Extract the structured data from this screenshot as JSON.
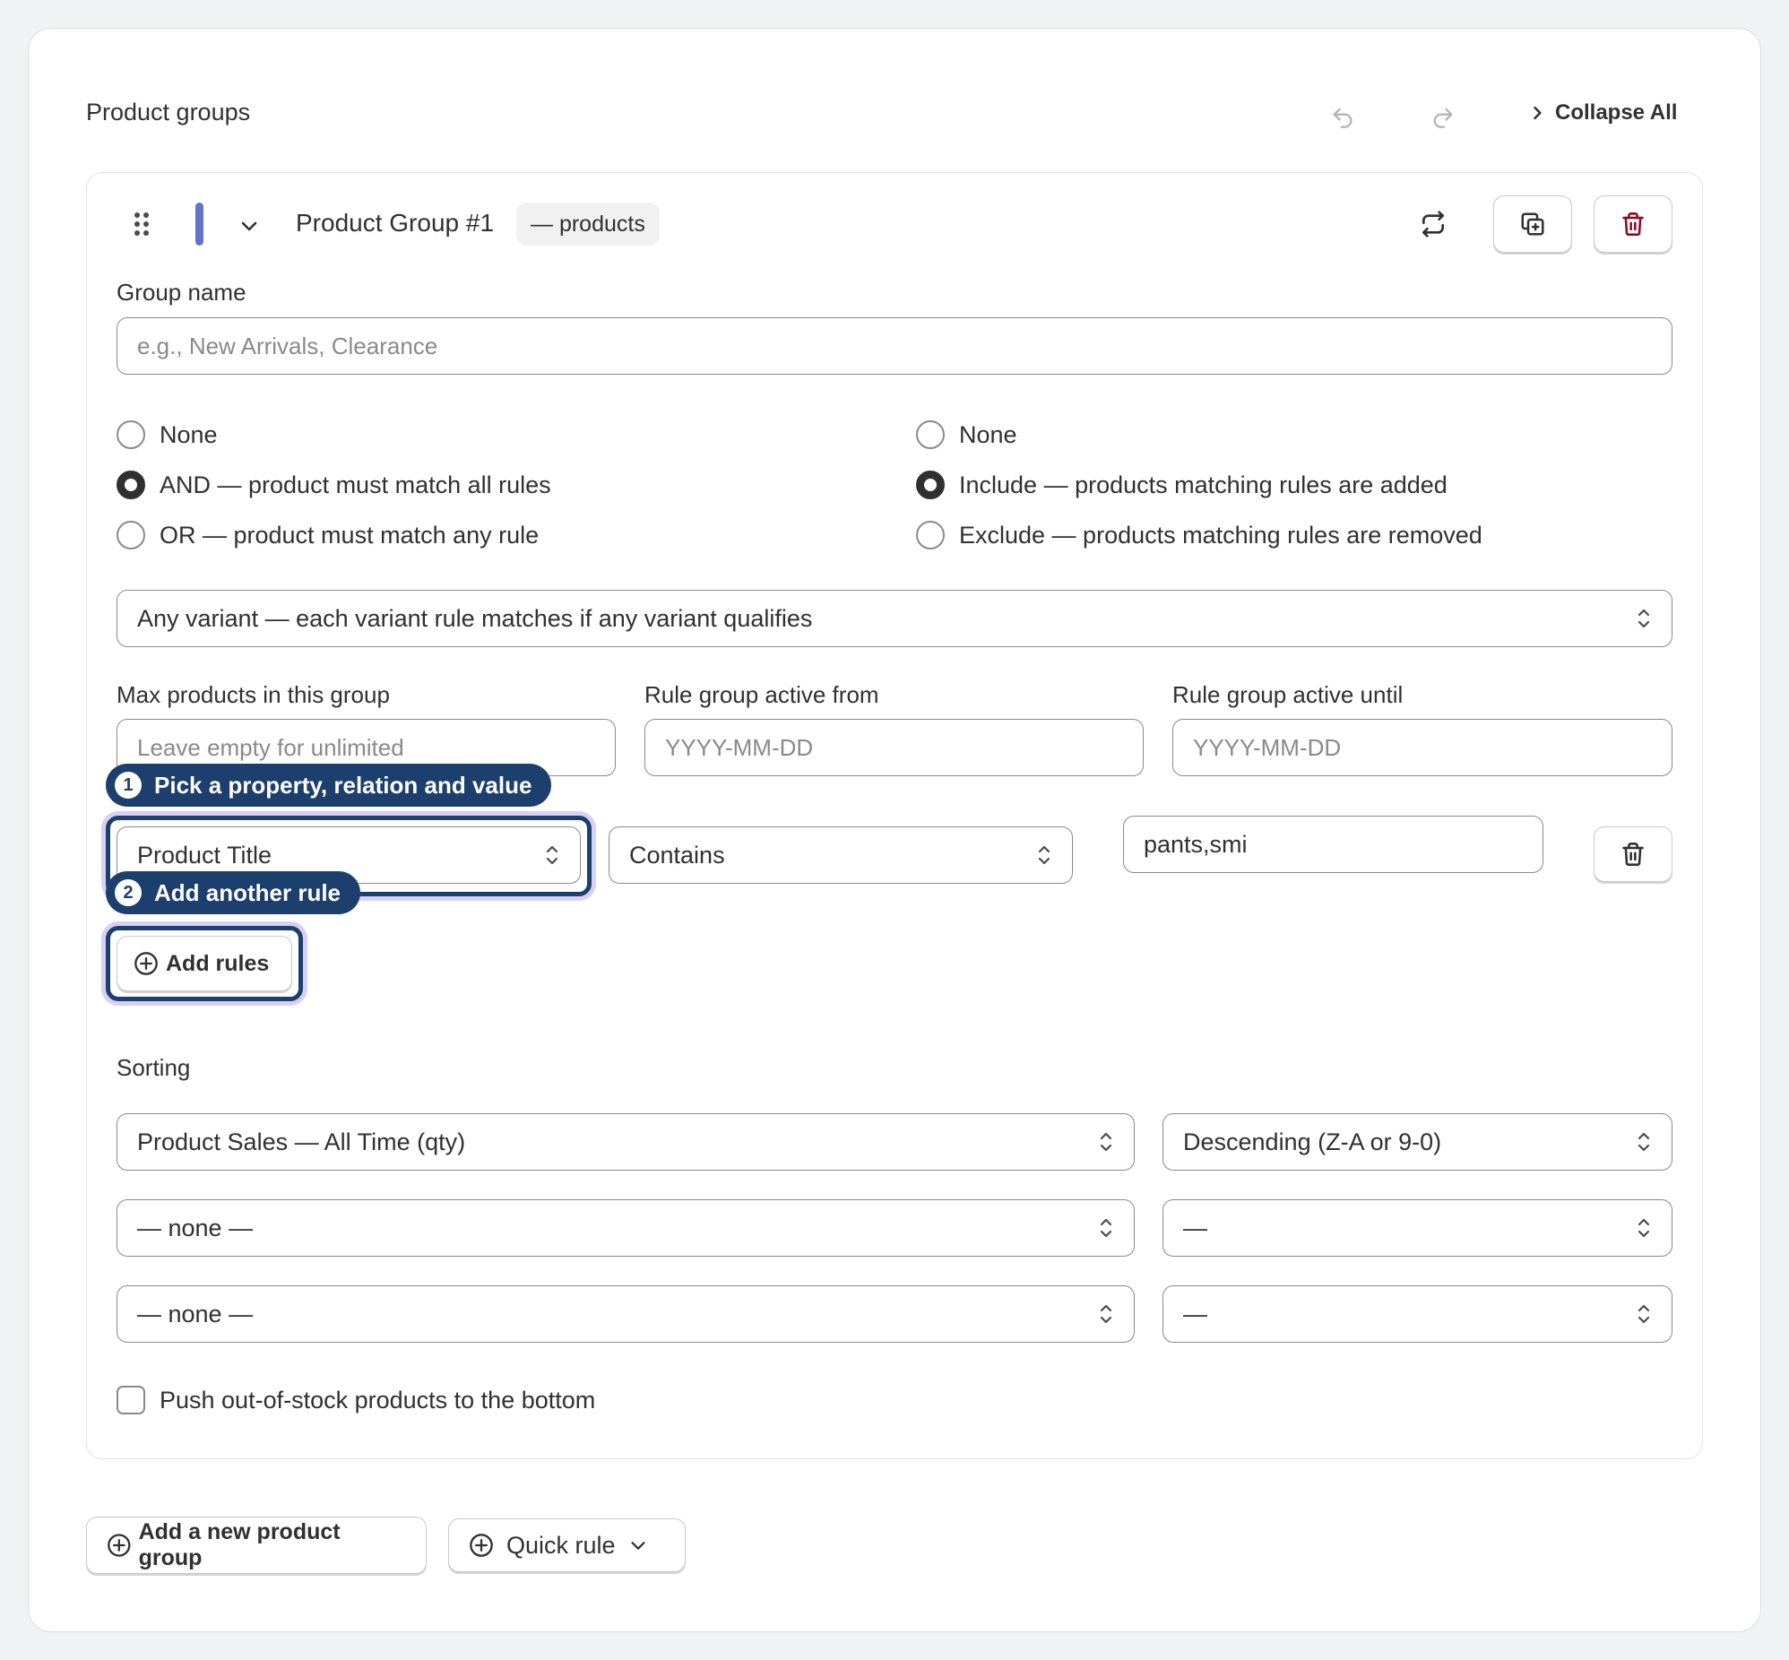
{
  "header": {
    "title": "Product groups",
    "collapse_label": "Collapse All"
  },
  "group": {
    "title": "Product Group #1",
    "count_pill": "— products",
    "color": "#6273c9",
    "name_label": "Group name",
    "name_placeholder": "e.g., New Arrivals, Clearance",
    "match_options": [
      {
        "label": "None",
        "selected": false
      },
      {
        "label": "AND — product must match all rules",
        "selected": true
      },
      {
        "label": "OR — product must match any rule",
        "selected": false
      }
    ],
    "mode_options": [
      {
        "label": "None",
        "selected": false
      },
      {
        "label": "Include — products matching rules are added",
        "selected": true
      },
      {
        "label": "Exclude — products matching rules are removed",
        "selected": false
      }
    ],
    "variant_select": "Any variant — each variant rule matches if any variant qualifies",
    "max_label": "Max products in this group",
    "max_placeholder": "Leave empty for unlimited",
    "from_label": "Rule group active from",
    "from_placeholder": "YYYY-MM-DD",
    "until_label": "Rule group active until",
    "until_placeholder": "YYYY-MM-DD",
    "rule": {
      "property": "Product Title",
      "relation": "Contains",
      "value": "pants,smi"
    },
    "add_rules_label": "Add rules",
    "sorting_label": "Sorting",
    "sorts": [
      {
        "field": "Product Sales — All Time (qty)",
        "order": "Descending (Z-A or 9-0)"
      },
      {
        "field": "— none —",
        "order": "—"
      },
      {
        "field": "— none —",
        "order": "—"
      }
    ],
    "oos_label": "Push out-of-stock products to the bottom",
    "oos_checked": false
  },
  "tips": [
    {
      "num": "1",
      "text": "Pick a property, relation and value"
    },
    {
      "num": "2",
      "text": "Add another rule"
    }
  ],
  "footer": {
    "add_group_label": "Add a new product group",
    "quick_rule_label": "Quick rule"
  },
  "colors": {
    "tip_bg": "#1d3f6e",
    "danger": "#8e0b21"
  }
}
